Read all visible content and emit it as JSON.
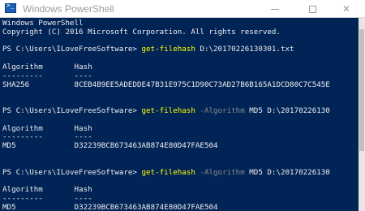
{
  "window": {
    "title": "Windows PowerShell",
    "close_glyph": "✕"
  },
  "console": {
    "banner": [
      "Windows PowerShell",
      "Copyright (C) 2016 Microsoft Corporation. All rights reserved."
    ],
    "prompt": "PS C:\\Users\\ILoveFreeSoftware> ",
    "command_name": "get-filehash",
    "blocks": [
      {
        "param": "",
        "value": " D:\\20170226130301.txt",
        "header_algorithm": "Algorithm",
        "header_hash": "Hash",
        "sep_algorithm": "---------",
        "sep_hash": "----",
        "algorithm": "SHA256",
        "hash": "8CEB4B9EE5ADEDDE47B31E975C1D90C73AD27B6B165A1DCD80C7C545E"
      },
      {
        "param": " -Algorithm",
        "value": " MD5 D:\\20170226130",
        "header_algorithm": "Algorithm",
        "header_hash": "Hash",
        "sep_algorithm": "---------",
        "sep_hash": "----",
        "algorithm": "MD5",
        "hash": "D32239BCB673463AB874E80D47FAE504"
      },
      {
        "param": " -Algorithm",
        "value": " MD5 D:\\20170226130",
        "header_algorithm": "Algorithm",
        "header_hash": "Hash",
        "sep_algorithm": "---------",
        "sep_hash": "----",
        "algorithm": "MD5",
        "hash": "D32239BCB673463AB874E80D47FAE504"
      }
    ]
  },
  "colors": {
    "console_background": "#012456",
    "command": "#ffff00",
    "parameter": "#8a8a8a",
    "text": "#eeedf0"
  }
}
